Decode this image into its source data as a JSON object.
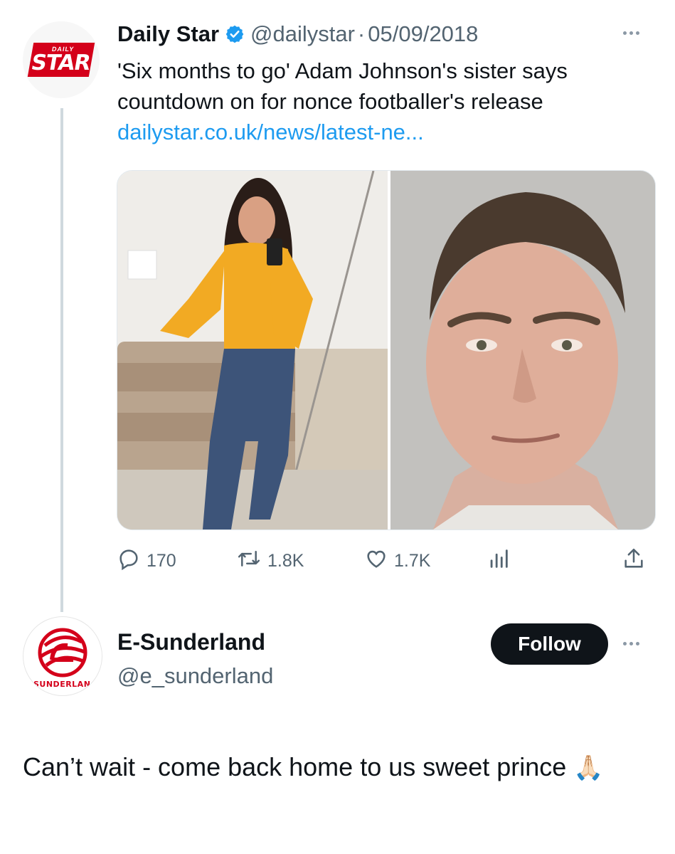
{
  "tweet": {
    "author": "Daily Star",
    "handle": "@dailystar",
    "separator": "·",
    "date": "05/09/2018",
    "text": "'Six months to go' Adam Johnson's sister says countdown on for nonce footballer's release",
    "link": "dailystar.co.uk/news/latest-ne...",
    "avatar": {
      "small_text": "DAILY",
      "big_text": "STAR"
    },
    "stats": {
      "replies": "170",
      "retweets": "1.8K",
      "likes": "1.7K"
    },
    "icons": [
      "verified-badge-icon",
      "more-icon",
      "reply-icon",
      "retweet-icon",
      "like-icon",
      "views-icon",
      "share-icon"
    ]
  },
  "reply": {
    "author": "E-Sunderland",
    "handle": "@e_sunderland",
    "avatar_text": "SUNDERLAN",
    "follow_label": "Follow",
    "text": "Can’t wait - come back home to us sweet prince",
    "emoji": "🙏🏻"
  },
  "colors": {
    "text": "#0f1419",
    "muted": "#536471",
    "link": "#1d9bf0",
    "verified": "#1d9bf0",
    "brand_red": "#d4001a",
    "follow_bg": "#0f1419"
  }
}
